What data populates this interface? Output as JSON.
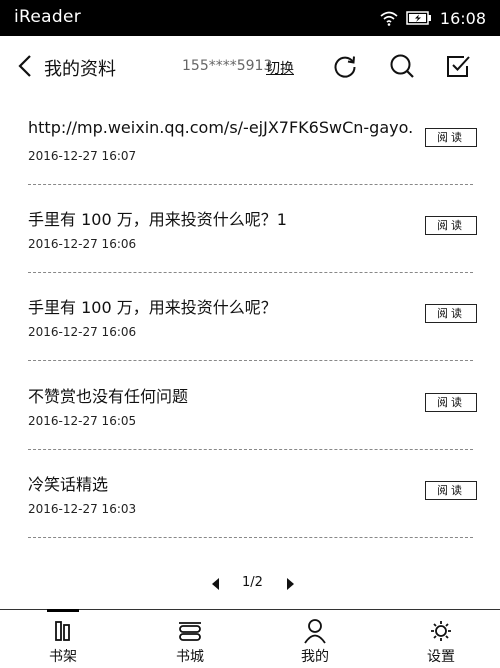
{
  "status_bar": {
    "app_name": "iReader",
    "time": "16:08",
    "icons": [
      "wifi-icon",
      "battery-icon"
    ]
  },
  "header": {
    "title": "我的资料",
    "account": "155****5913",
    "switch_label": "切换",
    "icons": [
      "back-icon",
      "refresh-icon",
      "search-icon",
      "select-icon"
    ]
  },
  "list": {
    "items": [
      {
        "title": "http://mp.weixin.qq.com/s/-ejJX7FK6SwCn-gayo.",
        "date": "2016-12-27 16:07",
        "action": "阅读"
      },
      {
        "title": "手里有 100 万，用来投资什么呢？1",
        "date": "2016-12-27 16:06",
        "action": "阅读"
      },
      {
        "title": "手里有 100 万，用来投资什么呢？",
        "date": "2016-12-27 16:06",
        "action": "阅读"
      },
      {
        "title": "不赞赏也没有任何问题",
        "date": "2016-12-27 16:05",
        "action": "阅读"
      },
      {
        "title": "冷笑话精选",
        "date": "2016-12-27 16:03",
        "action": "阅读"
      }
    ]
  },
  "pager": {
    "label": "1/2"
  },
  "tabbar": {
    "tabs": [
      {
        "label": "书架",
        "icon": "bookshelf-icon",
        "active": true
      },
      {
        "label": "书城",
        "icon": "bookstore-icon",
        "active": false
      },
      {
        "label": "我的",
        "icon": "profile-icon",
        "active": false
      },
      {
        "label": "设置",
        "icon": "settings-icon",
        "active": false
      }
    ]
  }
}
